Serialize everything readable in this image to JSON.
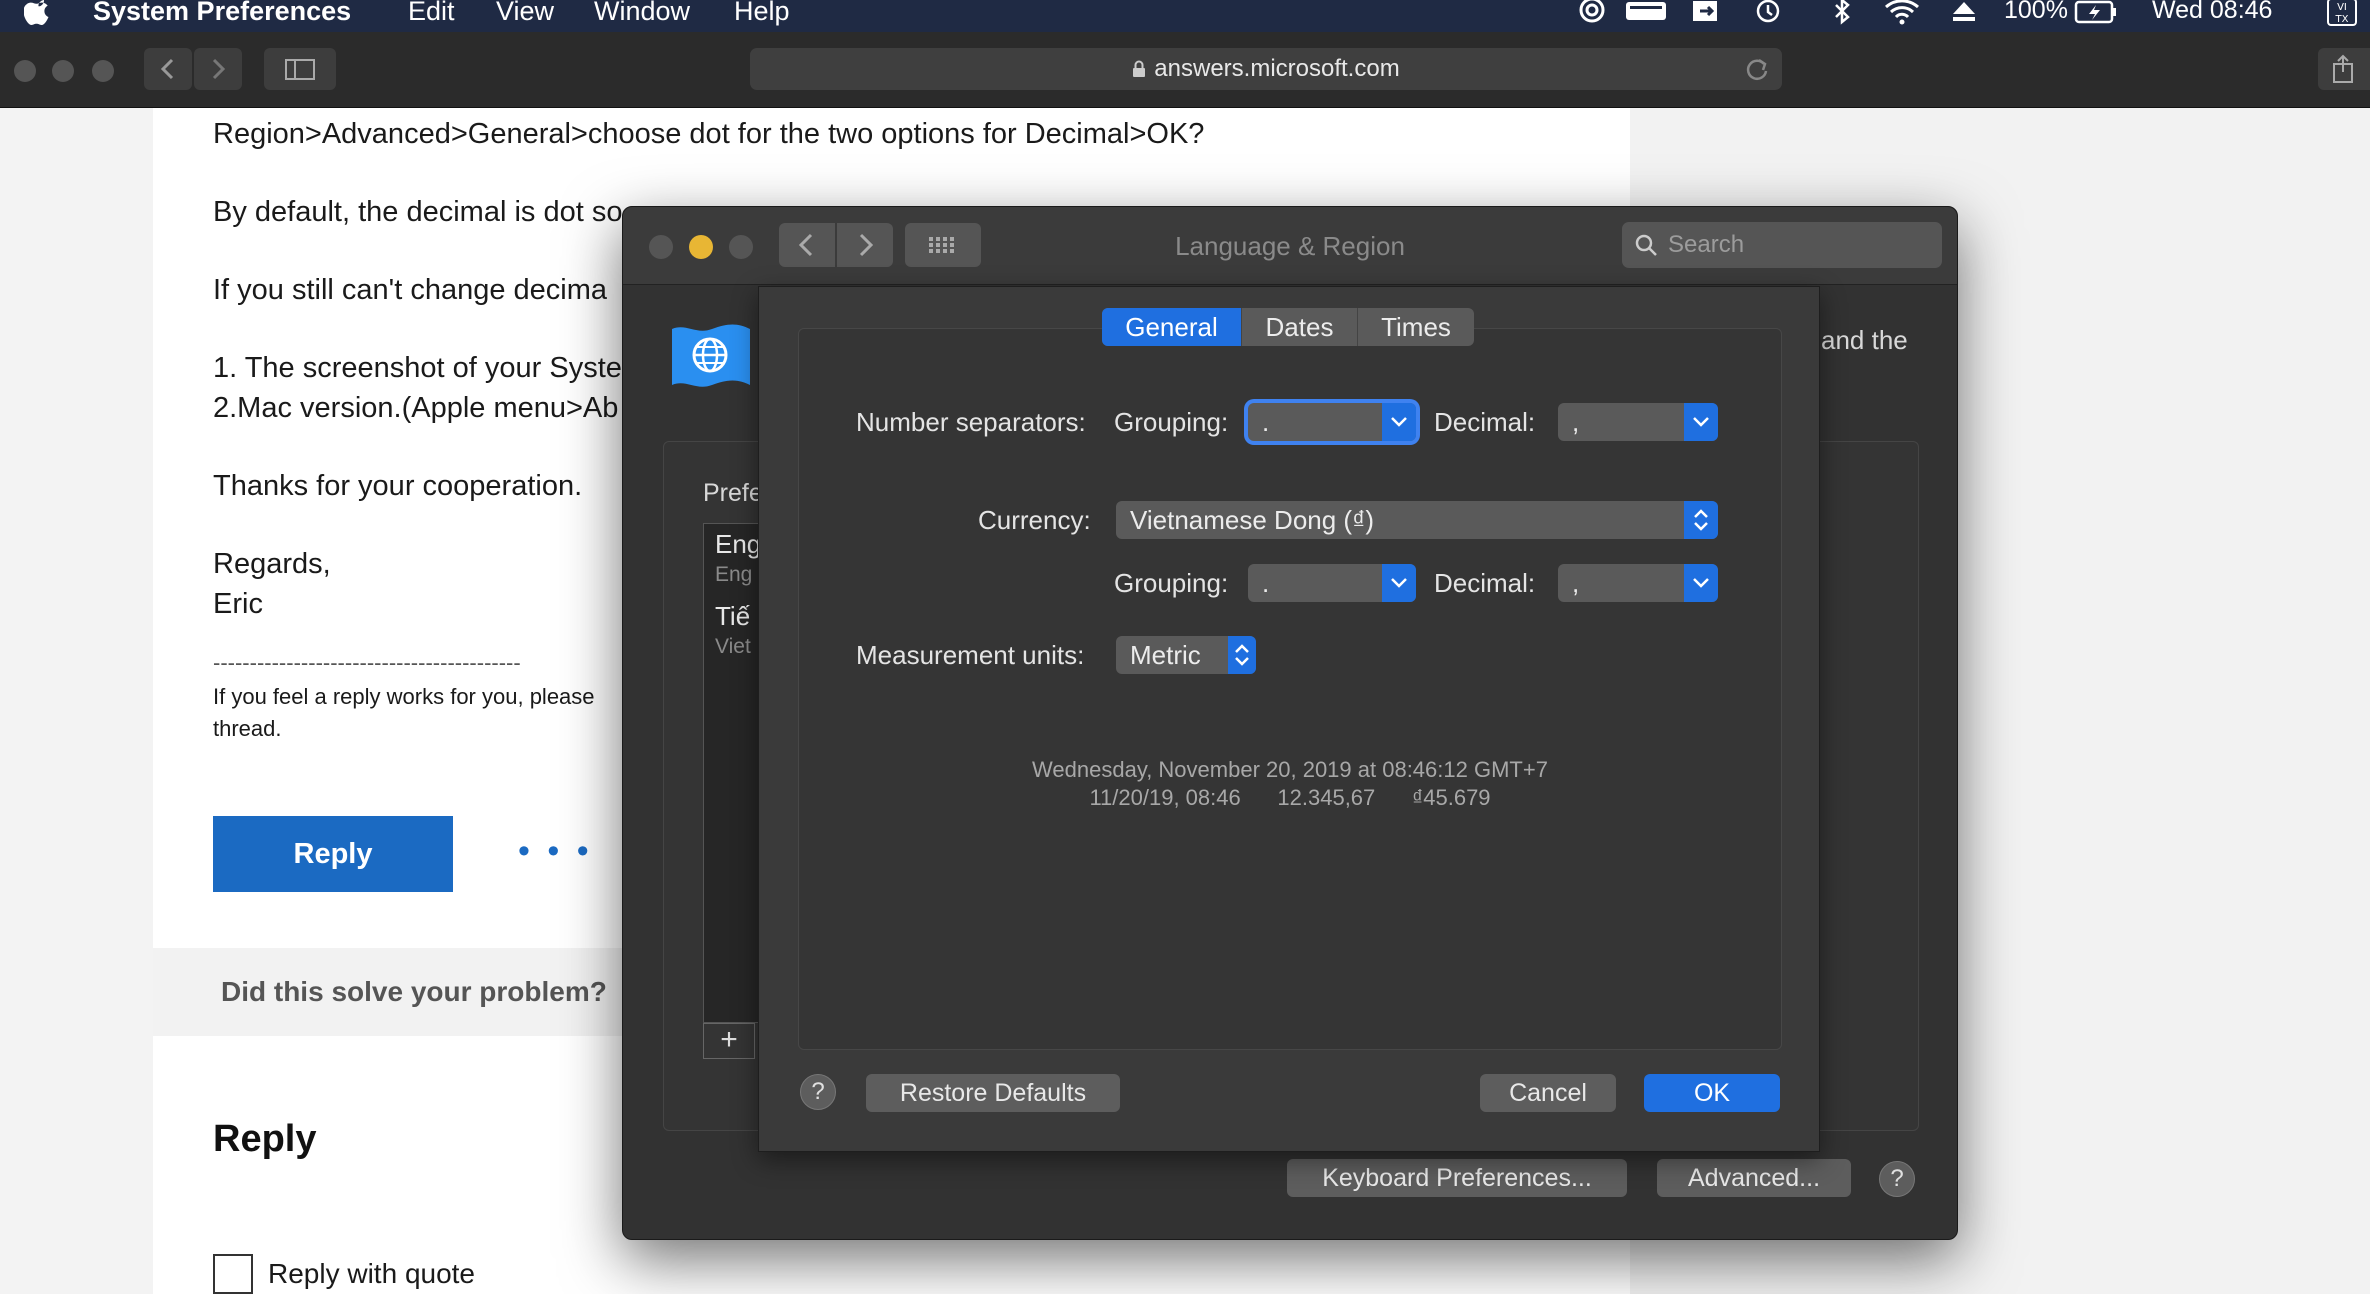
{
  "menubar": {
    "app_name": "System Preferences",
    "items": [
      "Edit",
      "View",
      "Window",
      "Help"
    ],
    "battery": "100%",
    "clock": "Wed 08:46",
    "input_source": "VI TX"
  },
  "browser": {
    "url": "answers.microsoft.com"
  },
  "article": {
    "line1": "Region>Advanced>General>choose dot for the two options for Decimal>OK?",
    "line2": "By default, the decimal is dot so",
    "line3": "If you still can't change decima",
    "line4": "1. The screenshot of your Syste",
    "line5": "2.Mac version.(Apple menu>Ab",
    "line6": "Thanks for your cooperation.",
    "line7": "Regards,",
    "line8": "Eric",
    "divider": "------------------------------------------",
    "note1": "If you feel a reply works for you, please",
    "note2": "thread.",
    "reply_button": "Reply",
    "more": "• • •",
    "solve": "Did this solve your problem?",
    "reply_heading": "Reply",
    "reply_with_quote": "Reply with quote"
  },
  "prefs_window": {
    "title": "Language & Region",
    "search_placeholder": "Search",
    "preferred_label": "Prefe",
    "languages": [
      {
        "name": "Eng",
        "sub": "Eng"
      },
      {
        "name": "Tiế",
        "sub": "Viet"
      }
    ],
    "behind_text": "and the",
    "add_label": "+",
    "keyboard_prefs_button": "Keyboard Preferences...",
    "advanced_button": "Advanced...",
    "help": "?"
  },
  "sheet": {
    "tabs": [
      "General",
      "Dates",
      "Times"
    ],
    "active_tab": "General",
    "number_separators_label": "Number separators:",
    "grouping_label": "Grouping:",
    "decimal_label": "Decimal:",
    "number_grouping_value": ".",
    "number_decimal_value": ",",
    "currency_label": "Currency:",
    "currency_value": "Vietnamese Dong (₫)",
    "currency_grouping_value": ".",
    "currency_decimal_value": ",",
    "measurement_label": "Measurement units:",
    "measurement_value": "Metric",
    "preview_line1": "Wednesday, November 20, 2019 at 08:46:12 GMT+7",
    "preview_line2": "11/20/19, 08:46      12.345,67      ₫45.679",
    "help": "?",
    "restore_defaults": "Restore Defaults",
    "cancel": "Cancel",
    "ok": "OK"
  },
  "colors": {
    "accent_blue": "#1f6fe0",
    "link_blue": "#1b6ac2",
    "close": "#555555",
    "minimize": "#e8b634"
  }
}
